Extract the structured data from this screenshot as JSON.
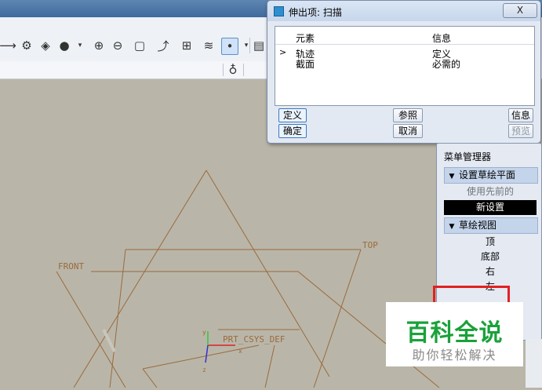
{
  "dialog": {
    "title": "伸出项: 扫描",
    "close_label": "X",
    "columns": [
      "元素",
      "信息"
    ],
    "rows": [
      {
        "element": "轨迹",
        "info": "定义"
      },
      {
        "element": "截面",
        "info": "必需的"
      }
    ],
    "buttons": {
      "define": "定义",
      "refs": "参照",
      "info": "信息",
      "ok": "确定",
      "cancel": "取消",
      "preview": "预览"
    }
  },
  "menu_manager": {
    "title": "菜单管理器",
    "group1": "设置草绘平面",
    "group1_items": [
      "使用先前的",
      "新设置"
    ],
    "group2": "草绘视图",
    "group2_items": [
      "顶",
      "底部",
      "右",
      "左"
    ]
  },
  "canvas": {
    "labels": {
      "front": "FRONT",
      "top": "TOP",
      "csys": "PRT_CSYS_DEF",
      "x": "x",
      "y": "y",
      "z": "z"
    }
  },
  "watermark": {
    "main": "百科全说",
    "sub": "助你轻松解决"
  },
  "colors": {
    "datum": "#9b6a3c",
    "background": "#b9b6a9",
    "watermark_green": "#1aa13a",
    "highlight_red": "#e02222"
  }
}
